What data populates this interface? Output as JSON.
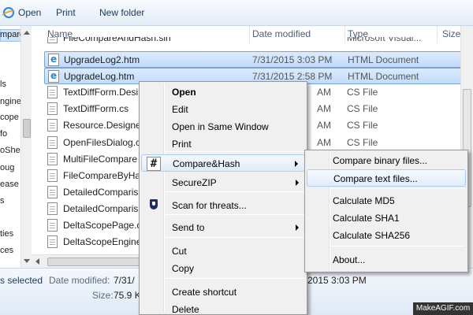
{
  "toolbar": {
    "open_label": "Open",
    "print_label": "Print",
    "new_folder_label": "New folder"
  },
  "nav": {
    "items": [
      "mpare",
      "ls",
      "ngine",
      "cope",
      "fo",
      "oShe",
      "oug",
      "ease",
      "s",
      "ties",
      "ces"
    ]
  },
  "columns": {
    "name": "Name",
    "date_modified": "Date modified",
    "type": "Type",
    "size": "Size"
  },
  "files": [
    {
      "name": "FileCompareAndHash.sln",
      "date": "",
      "type": "Microsoft Visual..."
    },
    {
      "name": "UpgradeLog2.htm",
      "date": "7/31/2015 3:03 PM",
      "type": "HTML Document"
    },
    {
      "name": "UpgradeLog.htm",
      "date": "7/31/2015 2:58 PM",
      "type": "HTML Document"
    },
    {
      "name": "TextDiffForm.Desi",
      "date": "AM",
      "type": "CS File"
    },
    {
      "name": "TextDiffForm.cs",
      "date": "AM",
      "type": "CS File"
    },
    {
      "name": "Resource.Designe",
      "date": "AM",
      "type": "CS File"
    },
    {
      "name": "OpenFilesDialog.c",
      "date": "AM",
      "type": "CS File"
    },
    {
      "name": "MultiFileCompare",
      "date": "",
      "type": ""
    },
    {
      "name": "FileCompareByHa",
      "date": "",
      "type": ""
    },
    {
      "name": "DetailedComparis",
      "date": "",
      "type": ""
    },
    {
      "name": "DetailedComparis",
      "date": "",
      "type": ""
    },
    {
      "name": "DeltaScopePage.c",
      "date": "",
      "type": ""
    },
    {
      "name": "DeltaScopeEngine",
      "date": "",
      "type": ""
    }
  ],
  "details": {
    "selected": "s selected",
    "date_label": "Date modified:",
    "date_value": "7/31/",
    "date_value_tail": "2015 3:03 PM",
    "size_label": "Size:",
    "size_value": "75.9 K"
  },
  "context_menu": {
    "items": {
      "open": "Open",
      "edit": "Edit",
      "open_same_window": "Open in Same Window",
      "print": "Print",
      "compare_hash": "Compare&Hash",
      "securezip": "SecureZIP",
      "scan": "Scan for threats...",
      "send_to": "Send to",
      "cut": "Cut",
      "copy": "Copy",
      "create_shortcut": "Create shortcut",
      "delete": "Delete"
    }
  },
  "submenu": {
    "items": {
      "binary": "Compare binary files...",
      "text": "Compare text files...",
      "md5": "Calculate MD5",
      "sha1": "Calculate SHA1",
      "sha256": "Calculate SHA256",
      "about": "About..."
    }
  },
  "watermark": "MakeAGIF.com"
}
